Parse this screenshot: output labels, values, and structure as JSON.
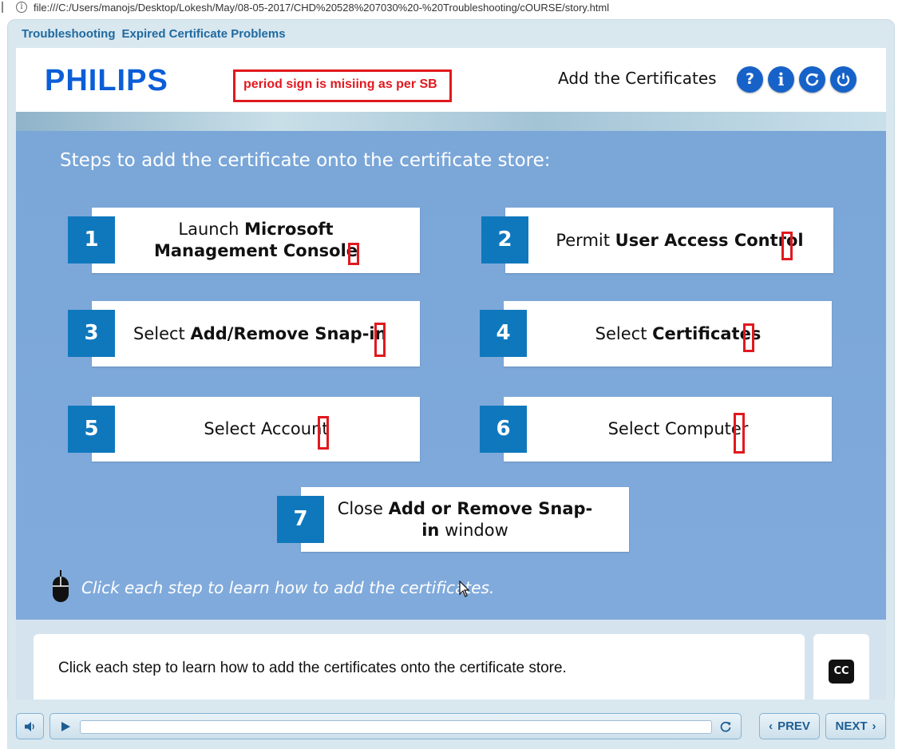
{
  "browser": {
    "url": "file:///C:/Users/manojs/Desktop/Lokesh/May/08-05-2017/CHD%20528%207030%20-%20Troubleshooting/cOURSE/story.html"
  },
  "course": {
    "title_part1": "Troubleshooting",
    "title_part2": "Expired Certificate Problems"
  },
  "slide": {
    "logo": "PHILIPS",
    "annotation": "period sign is misiing as per SB",
    "title": "Add the Certificates",
    "header_buttons": {
      "help": "?",
      "info": "i"
    },
    "intro": "Steps to add the certificate onto the certificate store:",
    "steps": [
      {
        "num": "1",
        "pre": "Launch ",
        "bold": "Microsoft Management Console",
        "post": ""
      },
      {
        "num": "2",
        "pre": "Permit ",
        "bold": "User Access Control",
        "post": ""
      },
      {
        "num": "3",
        "pre": "Select ",
        "bold": "Add/Remove Snap-in",
        "post": ""
      },
      {
        "num": "4",
        "pre": "Select ",
        "bold": "Certificates",
        "post": ""
      },
      {
        "num": "5",
        "pre": "Select Account",
        "bold": "",
        "post": ""
      },
      {
        "num": "6",
        "pre": "Select Computer",
        "bold": "",
        "post": ""
      },
      {
        "num": "7",
        "pre": "Close ",
        "bold": "Add or Remove Snap-in",
        "post": " window"
      }
    ],
    "hint": "Click each step to learn how to add the certificates."
  },
  "caption": {
    "text": "Click each step to learn how to add the certificates onto the certificate store.",
    "cc_label": "CC"
  },
  "controls": {
    "prev_label": "PREV",
    "next_label": "NEXT",
    "progress": 0
  },
  "colors": {
    "accent_blue": "#1762c9",
    "step_number_bg": "#0f78bd",
    "annotation_red": "#e0191f",
    "slide_bg": "#7fa9d8"
  }
}
